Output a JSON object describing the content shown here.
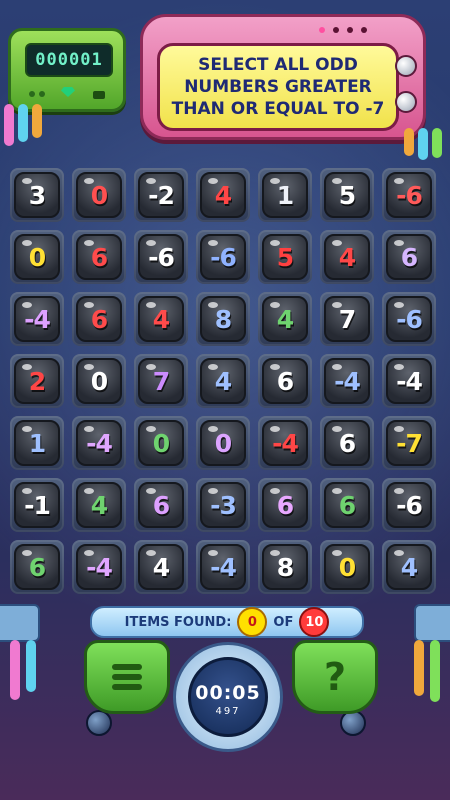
{
  "score": {
    "value": "000001"
  },
  "instruction": {
    "text": "Select all odd numbers greater than or equal to -7"
  },
  "grid": {
    "rows": [
      [
        {
          "text": "3",
          "color": "#ffffff"
        },
        {
          "text": "0",
          "color": "#ff5050"
        },
        {
          "text": "-2",
          "color": "#ffffff"
        },
        {
          "text": "4",
          "color": "#ff4646"
        },
        {
          "text": "1",
          "color": "#eef1f8"
        },
        {
          "text": "5",
          "color": "#ffffff"
        },
        {
          "text": "-6",
          "color": "#ff5a5a"
        }
      ],
      [
        {
          "text": "0",
          "color": "#ffe034"
        },
        {
          "text": "6",
          "color": "#ff4b4b"
        },
        {
          "text": "-6",
          "color": "#ffffff"
        },
        {
          "text": "-6",
          "color": "#8fb2ff"
        },
        {
          "text": "5",
          "color": "#ff4040"
        },
        {
          "text": "4",
          "color": "#ff4848"
        },
        {
          "text": "6",
          "color": "#d6b6ff"
        }
      ],
      [
        {
          "text": "-4",
          "color": "#dda0ff"
        },
        {
          "text": "6",
          "color": "#ff4b4b"
        },
        {
          "text": "4",
          "color": "#ff4b4b"
        },
        {
          "text": "8",
          "color": "#9fc0ff"
        },
        {
          "text": "4",
          "color": "#6fd36f"
        },
        {
          "text": "7",
          "color": "#ffffff"
        },
        {
          "text": "-6",
          "color": "#9fc0ff"
        }
      ],
      [
        {
          "text": "2",
          "color": "#ff4646"
        },
        {
          "text": "0",
          "color": "#ffffff"
        },
        {
          "text": "7",
          "color": "#cc8cff"
        },
        {
          "text": "4",
          "color": "#9fc0ff"
        },
        {
          "text": "6",
          "color": "#ffffff"
        },
        {
          "text": "-4",
          "color": "#9fc0ff"
        },
        {
          "text": "-4",
          "color": "#ffffff"
        }
      ],
      [
        {
          "text": "1",
          "color": "#9fc0ff"
        },
        {
          "text": "-4",
          "color": "#e0a6ff"
        },
        {
          "text": "0",
          "color": "#6fd36f"
        },
        {
          "text": "0",
          "color": "#dca4ff"
        },
        {
          "text": "-4",
          "color": "#ff4646"
        },
        {
          "text": "6",
          "color": "#ffffff"
        },
        {
          "text": "-7",
          "color": "#ffe034"
        }
      ],
      [
        {
          "text": "-1",
          "color": "#ffffff"
        },
        {
          "text": "4",
          "color": "#6fd36f"
        },
        {
          "text": "6",
          "color": "#dda0ff"
        },
        {
          "text": "-3",
          "color": "#9fc0ff"
        },
        {
          "text": "6",
          "color": "#e8a8ff"
        },
        {
          "text": "6",
          "color": "#6fd36f"
        },
        {
          "text": "-6",
          "color": "#ffffff"
        }
      ],
      [
        {
          "text": "6",
          "color": "#6fd36f"
        },
        {
          "text": "-4",
          "color": "#e0a6ff"
        },
        {
          "text": "4",
          "color": "#ffffff"
        },
        {
          "text": "-4",
          "color": "#9fc0ff"
        },
        {
          "text": "8",
          "color": "#ffffff"
        },
        {
          "text": "0",
          "color": "#ffe034"
        },
        {
          "text": "4",
          "color": "#9fc0ff"
        }
      ]
    ]
  },
  "found": {
    "label": "Items found:",
    "count": "0",
    "of_label": "of",
    "total": "10",
    "count_color": "#ffe000",
    "total_color": "#ff3b3b"
  },
  "timer": {
    "time": "00:05",
    "sub": "497"
  },
  "icons": {
    "menu": "menu-lines-icon",
    "help": "question-mark-icon",
    "gem": "gem-icon"
  }
}
